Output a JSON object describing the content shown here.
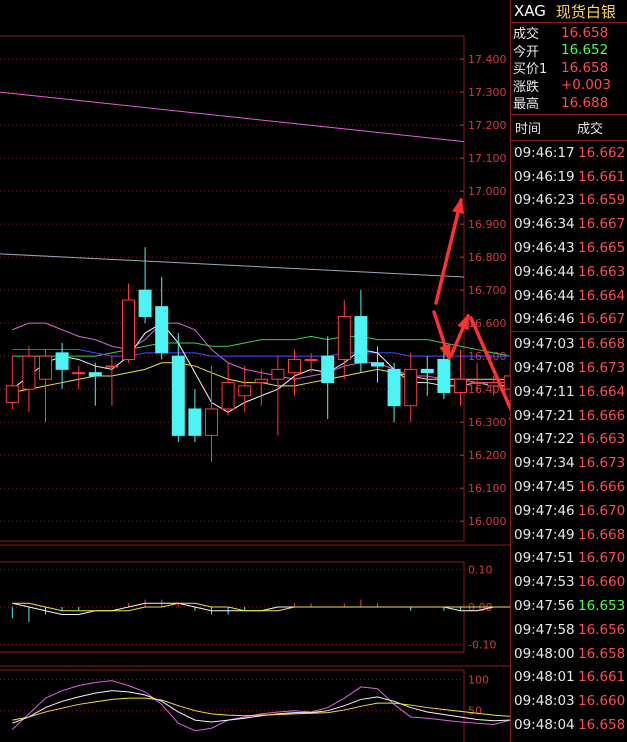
{
  "chart_data": {
    "type": "candlestick",
    "price_axis": {
      "ticks": [
        "17.400",
        "17.300",
        "17.200",
        "17.100",
        "17.000",
        "16.900",
        "16.800",
        "16.700",
        "16.600",
        "16.500",
        "16.400",
        "16.300",
        "16.200",
        "16.100",
        "16.000"
      ],
      "range": [
        15.94,
        17.47
      ]
    },
    "candles": [
      {
        "o": 16.36,
        "c": 16.41,
        "h": 16.5,
        "l": 16.34
      },
      {
        "o": 16.4,
        "c": 16.5,
        "h": 16.53,
        "l": 16.33
      },
      {
        "o": 16.43,
        "c": 16.5,
        "h": 16.52,
        "l": 16.3
      },
      {
        "o": 16.51,
        "c": 16.46,
        "h": 16.54,
        "l": 16.4
      },
      {
        "o": 16.45,
        "c": 16.45,
        "h": 16.47,
        "l": 16.4
      },
      {
        "o": 16.45,
        "c": 16.44,
        "h": 16.48,
        "l": 16.35
      },
      {
        "o": 16.47,
        "c": 16.47,
        "h": 16.5,
        "l": 16.35
      },
      {
        "o": 16.49,
        "c": 16.67,
        "h": 16.72,
        "l": 16.48
      },
      {
        "o": 16.7,
        "c": 16.62,
        "h": 16.83,
        "l": 16.6
      },
      {
        "o": 16.65,
        "c": 16.51,
        "h": 16.74,
        "l": 16.49
      },
      {
        "o": 16.5,
        "c": 16.26,
        "h": 16.57,
        "l": 16.24
      },
      {
        "o": 16.34,
        "c": 16.26,
        "h": 16.4,
        "l": 16.24
      },
      {
        "o": 16.26,
        "c": 16.34,
        "h": 16.47,
        "l": 16.18
      },
      {
        "o": 16.34,
        "c": 16.42,
        "h": 16.48,
        "l": 16.32
      },
      {
        "o": 16.38,
        "c": 16.41,
        "h": 16.47,
        "l": 16.33
      },
      {
        "o": 16.42,
        "c": 16.43,
        "h": 16.46,
        "l": 16.35
      },
      {
        "o": 16.43,
        "c": 16.46,
        "h": 16.5,
        "l": 16.26
      },
      {
        "o": 16.45,
        "c": 16.49,
        "h": 16.52,
        "l": 16.38
      },
      {
        "o": 16.49,
        "c": 16.49,
        "h": 16.51,
        "l": 16.45
      },
      {
        "o": 16.5,
        "c": 16.42,
        "h": 16.56,
        "l": 16.31
      },
      {
        "o": 16.49,
        "c": 16.62,
        "h": 16.67,
        "l": 16.43
      },
      {
        "o": 16.62,
        "c": 16.48,
        "h": 16.7,
        "l": 16.45
      },
      {
        "o": 16.48,
        "c": 16.47,
        "h": 16.53,
        "l": 16.42
      },
      {
        "o": 16.46,
        "c": 16.35,
        "h": 16.48,
        "l": 16.3
      },
      {
        "o": 16.35,
        "c": 16.46,
        "h": 16.51,
        "l": 16.3
      },
      {
        "o": 16.46,
        "c": 16.45,
        "h": 16.5,
        "l": 16.38
      },
      {
        "o": 16.49,
        "c": 16.39,
        "h": 16.54,
        "l": 16.37
      },
      {
        "o": 16.39,
        "c": 16.43,
        "h": 16.52,
        "l": 16.35
      },
      {
        "o": 16.42,
        "c": 16.42,
        "h": 16.48,
        "l": 16.39
      },
      {
        "o": 16.41,
        "c": 16.42,
        "h": 16.44,
        "l": 16.38
      },
      {
        "o": 16.4,
        "c": 16.44,
        "h": 16.48,
        "l": 16.37
      },
      {
        "o": 16.45,
        "c": 16.66,
        "h": 16.73,
        "l": 16.43
      },
      {
        "o": 16.67,
        "c": 16.67,
        "h": 16.69,
        "l": 16.65
      }
    ],
    "overlay_lines": [
      {
        "color": "#e060e0",
        "values": [
          17.3,
          17.15
        ]
      },
      {
        "color": "#9aa7b8",
        "values": [
          16.81,
          16.74
        ]
      },
      {
        "color": "#e060e0",
        "values": [
          16.58,
          16.6,
          16.6,
          16.58,
          16.56,
          16.55,
          16.53,
          16.52,
          16.55,
          16.6,
          16.6,
          16.58,
          16.52,
          16.48,
          16.46,
          16.45,
          16.44,
          16.43,
          16.44,
          16.45,
          16.47,
          16.48,
          16.48,
          16.46,
          16.44,
          16.44,
          16.43,
          16.43,
          16.42,
          16.42,
          16.42,
          16.46,
          16.5
        ]
      },
      {
        "color": "#3cd04a",
        "values": [
          16.5,
          16.5,
          16.5,
          16.5,
          16.5,
          16.5,
          16.51,
          16.52,
          16.53,
          16.54,
          16.54,
          16.54,
          16.53,
          16.53,
          16.54,
          16.55,
          16.55,
          16.55,
          16.56,
          16.55,
          16.56,
          16.56,
          16.55,
          16.55,
          16.55,
          16.55,
          16.54,
          16.53,
          16.52,
          16.51,
          16.5,
          16.5,
          16.5
        ]
      },
      {
        "color": "#4a4aff",
        "values": [
          16.52,
          16.52,
          16.52,
          16.52,
          16.52,
          16.51,
          16.5,
          16.5,
          16.51,
          16.51,
          16.51,
          16.51,
          16.5,
          16.5,
          16.5,
          16.5,
          16.5,
          16.5,
          16.5,
          16.5,
          16.51,
          16.51,
          16.51,
          16.51,
          16.5,
          16.5,
          16.5,
          16.5,
          16.5,
          16.5,
          16.5,
          16.5,
          16.5
        ]
      },
      {
        "color": "#f5f5f5",
        "values": [
          16.4,
          16.44,
          16.48,
          16.5,
          16.49,
          16.47,
          16.46,
          16.5,
          16.57,
          16.6,
          16.54,
          16.45,
          16.36,
          16.33,
          16.36,
          16.38,
          16.4,
          16.44,
          16.46,
          16.45,
          16.48,
          16.52,
          16.51,
          16.46,
          16.42,
          16.42,
          16.41,
          16.41,
          16.42,
          16.41,
          16.41,
          16.45,
          16.53
        ]
      },
      {
        "color": "#f0e040",
        "values": [
          16.39,
          16.4,
          16.41,
          16.42,
          16.43,
          16.44,
          16.44,
          16.45,
          16.46,
          16.48,
          16.48,
          16.47,
          16.45,
          16.43,
          16.42,
          16.42,
          16.41,
          16.41,
          16.42,
          16.43,
          16.44,
          16.45,
          16.46,
          16.45,
          16.44,
          16.43,
          16.43,
          16.43,
          16.43,
          16.43,
          16.43,
          16.44,
          16.46
        ]
      }
    ],
    "macd_axis": {
      "ticks": [
        "0.10",
        "0.00",
        "-0.10"
      ],
      "range": [
        -0.12,
        0.12
      ]
    },
    "macd_bars": [
      -0.03,
      -0.04,
      -0.02,
      -0.01,
      -0.01,
      0.0,
      0.0,
      0.01,
      0.02,
      0.02,
      0.01,
      -0.01,
      -0.02,
      -0.02,
      -0.01,
      0.0,
      0.0,
      0.01,
      0.01,
      0.0,
      0.01,
      0.02,
      0.01,
      0.0,
      -0.01,
      0.0,
      -0.01,
      -0.01,
      0.0,
      0.0,
      0.01,
      0.03,
      0.05
    ],
    "macd_lines": [
      {
        "color": "#f5f5f5",
        "values": [
          0.01,
          0.0,
          -0.01,
          -0.02,
          -0.02,
          -0.01,
          -0.01,
          0.0,
          0.01,
          0.01,
          0.01,
          0.0,
          -0.01,
          -0.01,
          -0.01,
          -0.01,
          0.0,
          0.0,
          0.0,
          0.0,
          0.0,
          0.0,
          0.0,
          0.0,
          0.0,
          0.0,
          0.0,
          -0.01,
          -0.01,
          0.0,
          0.0,
          0.02,
          0.03
        ]
      },
      {
        "color": "#f0e040",
        "values": [
          0.01,
          0.01,
          0.0,
          -0.01,
          -0.01,
          -0.01,
          -0.01,
          -0.01,
          0.0,
          0.0,
          0.01,
          0.01,
          0.0,
          0.0,
          -0.01,
          -0.01,
          -0.01,
          0.0,
          0.0,
          0.0,
          0.0,
          0.0,
          0.0,
          0.0,
          0.0,
          0.0,
          0.0,
          0.0,
          0.0,
          0.0,
          0.0,
          0.01,
          0.02
        ]
      }
    ],
    "kdj_axis": {
      "ticks": [
        "100",
        "50"
      ],
      "range": [
        0,
        115
      ]
    },
    "kdj_lines": [
      {
        "color": "#e060e0",
        "values": [
          20,
          45,
          70,
          82,
          90,
          95,
          98,
          90,
          80,
          60,
          30,
          18,
          22,
          35,
          40,
          45,
          48,
          50,
          48,
          55,
          70,
          88,
          85,
          60,
          40,
          38,
          35,
          32,
          30,
          28,
          35,
          75,
          95
        ]
      },
      {
        "color": "#f5f5f5",
        "values": [
          30,
          40,
          55,
          65,
          72,
          78,
          82,
          80,
          75,
          65,
          48,
          35,
          32,
          35,
          38,
          42,
          45,
          47,
          47,
          50,
          58,
          68,
          72,
          65,
          55,
          48,
          44,
          40,
          36,
          34,
          35,
          55,
          72
        ]
      },
      {
        "color": "#f0e040",
        "values": [
          35,
          40,
          48,
          54,
          60,
          64,
          68,
          70,
          70,
          67,
          58,
          50,
          45,
          43,
          42,
          43,
          44,
          45,
          46,
          47,
          51,
          57,
          62,
          62,
          59,
          55,
          52,
          49,
          46,
          43,
          41,
          46,
          55
        ]
      }
    ]
  },
  "header": {
    "symbol": "XAG",
    "name": "现货白银"
  },
  "quotes": [
    {
      "label": "成交",
      "value": "16.658",
      "color": "red"
    },
    {
      "label": "今开",
      "value": "16.652",
      "color": "green"
    },
    {
      "label": "买价1",
      "value": "16.658",
      "color": "red"
    },
    {
      "label": "涨跌",
      "value": "+0.003",
      "color": "red"
    },
    {
      "label": "最高",
      "value": "16.688",
      "color": "red"
    }
  ],
  "ticks_header": {
    "time": "时间",
    "price": "成交"
  },
  "ticks_a": [
    {
      "time": "09:46:17",
      "price": "16.662",
      "color": "red"
    },
    {
      "time": "09:46:19",
      "price": "16.661",
      "color": "red"
    },
    {
      "time": "09:46:23",
      "price": "16.659",
      "color": "red"
    },
    {
      "time": "09:46:34",
      "price": "16.667",
      "color": "red"
    },
    {
      "time": "09:46:43",
      "price": "16.665",
      "color": "red"
    },
    {
      "time": "09:46:44",
      "price": "16.663",
      "color": "red"
    },
    {
      "time": "09:46:44",
      "price": "16.664",
      "color": "red"
    },
    {
      "time": "09:46:46",
      "price": "16.667",
      "color": "red"
    }
  ],
  "ticks_b": [
    {
      "time": "09:47:03",
      "price": "16.668",
      "color": "red"
    },
    {
      "time": "09:47:08",
      "price": "16.673",
      "color": "red"
    },
    {
      "time": "09:47:11",
      "price": "16.664",
      "color": "red"
    },
    {
      "time": "09:47:21",
      "price": "16.666",
      "color": "red"
    },
    {
      "time": "09:47:22",
      "price": "16.663",
      "color": "red"
    },
    {
      "time": "09:47:34",
      "price": "16.673",
      "color": "red"
    },
    {
      "time": "09:47:45",
      "price": "16.666",
      "color": "red"
    },
    {
      "time": "09:47:46",
      "price": "16.670",
      "color": "red"
    },
    {
      "time": "09:47:49",
      "price": "16.668",
      "color": "red"
    },
    {
      "time": "09:47:51",
      "price": "16.670",
      "color": "red"
    },
    {
      "time": "09:47:53",
      "price": "16.660",
      "color": "red"
    },
    {
      "time": "09:47:56",
      "price": "16.653",
      "color": "green"
    },
    {
      "time": "09:47:58",
      "price": "16.656",
      "color": "red"
    },
    {
      "time": "09:48:00",
      "price": "16.658",
      "color": "red"
    },
    {
      "time": "09:48:01",
      "price": "16.661",
      "color": "red"
    },
    {
      "time": "09:48:03",
      "price": "16.660",
      "color": "red"
    },
    {
      "time": "09:48:04",
      "price": "16.658",
      "color": "red"
    }
  ]
}
